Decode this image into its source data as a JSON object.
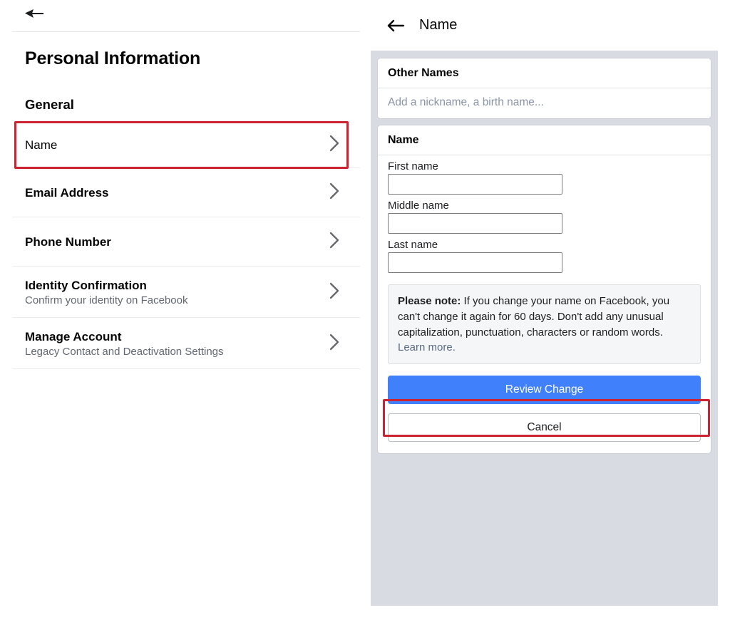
{
  "left_panel": {
    "back_icon": "back-arrow-icon",
    "page_title": "Personal Information",
    "section_title": "General",
    "items": [
      {
        "label": "Name",
        "sub": "",
        "chevron": "chevron-right-icon",
        "highlighted": true
      },
      {
        "label": "Email Address",
        "sub": "",
        "chevron": "chevron-right-icon",
        "highlighted": false
      },
      {
        "label": "Phone Number",
        "sub": "",
        "chevron": "chevron-right-icon",
        "highlighted": false
      },
      {
        "label": "Identity Confirmation",
        "sub": "Confirm your identity on Facebook",
        "chevron": "chevron-right-icon",
        "highlighted": false
      },
      {
        "label": "Manage Account",
        "sub": "Legacy Contact and Deactivation Settings",
        "chevron": "chevron-right-icon",
        "highlighted": false
      }
    ]
  },
  "right_panel": {
    "back_icon": "back-arrow-icon",
    "title": "Name",
    "other_names_card": {
      "header": "Other Names",
      "placeholder": "Add a nickname, a birth name..."
    },
    "name_card": {
      "header": "Name",
      "fields": [
        {
          "label": "First name",
          "value": "",
          "placeholder": ""
        },
        {
          "label": "Middle name",
          "value": "",
          "placeholder": ""
        },
        {
          "label": "Last name",
          "value": "",
          "placeholder": ""
        }
      ],
      "note": {
        "lead": "Please note:",
        "body": " If you change your name on Facebook, you can't change it again for 60 days. Don't add any unusual capitalization, punctuation, characters or random words. ",
        "link": "Learn more."
      },
      "primary_button": "Review Change",
      "secondary_button": "Cancel"
    }
  },
  "colors": {
    "highlight_red": "#cc2232",
    "primary_blue": "#4080fa",
    "panel_gray": "#d8dbe2",
    "note_gray": "#f5f6f7",
    "muted_text": "#606770",
    "placeholder_text": "#8a94a6",
    "link_gray_blue": "#5b6b84"
  }
}
